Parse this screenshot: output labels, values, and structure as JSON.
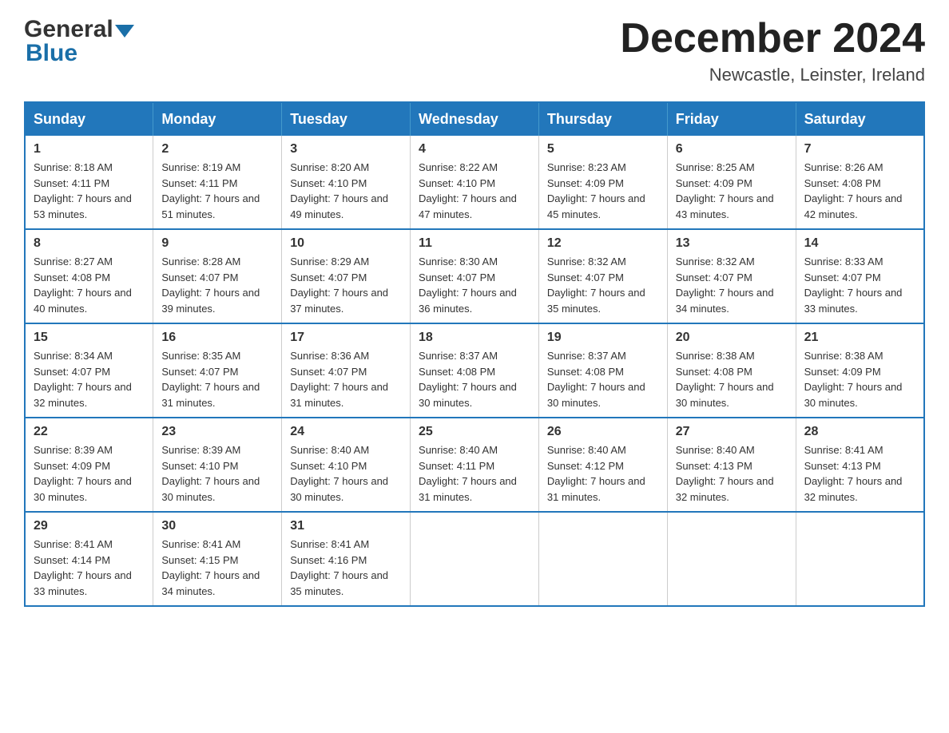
{
  "header": {
    "logo_general": "General",
    "logo_blue": "Blue",
    "month_title": "December 2024",
    "location": "Newcastle, Leinster, Ireland"
  },
  "weekdays": [
    "Sunday",
    "Monday",
    "Tuesday",
    "Wednesday",
    "Thursday",
    "Friday",
    "Saturday"
  ],
  "weeks": [
    [
      {
        "day": "1",
        "sunrise": "8:18 AM",
        "sunset": "4:11 PM",
        "daylight": "7 hours and 53 minutes."
      },
      {
        "day": "2",
        "sunrise": "8:19 AM",
        "sunset": "4:11 PM",
        "daylight": "7 hours and 51 minutes."
      },
      {
        "day": "3",
        "sunrise": "8:20 AM",
        "sunset": "4:10 PM",
        "daylight": "7 hours and 49 minutes."
      },
      {
        "day": "4",
        "sunrise": "8:22 AM",
        "sunset": "4:10 PM",
        "daylight": "7 hours and 47 minutes."
      },
      {
        "day": "5",
        "sunrise": "8:23 AM",
        "sunset": "4:09 PM",
        "daylight": "7 hours and 45 minutes."
      },
      {
        "day": "6",
        "sunrise": "8:25 AM",
        "sunset": "4:09 PM",
        "daylight": "7 hours and 43 minutes."
      },
      {
        "day": "7",
        "sunrise": "8:26 AM",
        "sunset": "4:08 PM",
        "daylight": "7 hours and 42 minutes."
      }
    ],
    [
      {
        "day": "8",
        "sunrise": "8:27 AM",
        "sunset": "4:08 PM",
        "daylight": "7 hours and 40 minutes."
      },
      {
        "day": "9",
        "sunrise": "8:28 AM",
        "sunset": "4:07 PM",
        "daylight": "7 hours and 39 minutes."
      },
      {
        "day": "10",
        "sunrise": "8:29 AM",
        "sunset": "4:07 PM",
        "daylight": "7 hours and 37 minutes."
      },
      {
        "day": "11",
        "sunrise": "8:30 AM",
        "sunset": "4:07 PM",
        "daylight": "7 hours and 36 minutes."
      },
      {
        "day": "12",
        "sunrise": "8:32 AM",
        "sunset": "4:07 PM",
        "daylight": "7 hours and 35 minutes."
      },
      {
        "day": "13",
        "sunrise": "8:32 AM",
        "sunset": "4:07 PM",
        "daylight": "7 hours and 34 minutes."
      },
      {
        "day": "14",
        "sunrise": "8:33 AM",
        "sunset": "4:07 PM",
        "daylight": "7 hours and 33 minutes."
      }
    ],
    [
      {
        "day": "15",
        "sunrise": "8:34 AM",
        "sunset": "4:07 PM",
        "daylight": "7 hours and 32 minutes."
      },
      {
        "day": "16",
        "sunrise": "8:35 AM",
        "sunset": "4:07 PM",
        "daylight": "7 hours and 31 minutes."
      },
      {
        "day": "17",
        "sunrise": "8:36 AM",
        "sunset": "4:07 PM",
        "daylight": "7 hours and 31 minutes."
      },
      {
        "day": "18",
        "sunrise": "8:37 AM",
        "sunset": "4:08 PM",
        "daylight": "7 hours and 30 minutes."
      },
      {
        "day": "19",
        "sunrise": "8:37 AM",
        "sunset": "4:08 PM",
        "daylight": "7 hours and 30 minutes."
      },
      {
        "day": "20",
        "sunrise": "8:38 AM",
        "sunset": "4:08 PM",
        "daylight": "7 hours and 30 minutes."
      },
      {
        "day": "21",
        "sunrise": "8:38 AM",
        "sunset": "4:09 PM",
        "daylight": "7 hours and 30 minutes."
      }
    ],
    [
      {
        "day": "22",
        "sunrise": "8:39 AM",
        "sunset": "4:09 PM",
        "daylight": "7 hours and 30 minutes."
      },
      {
        "day": "23",
        "sunrise": "8:39 AM",
        "sunset": "4:10 PM",
        "daylight": "7 hours and 30 minutes."
      },
      {
        "day": "24",
        "sunrise": "8:40 AM",
        "sunset": "4:10 PM",
        "daylight": "7 hours and 30 minutes."
      },
      {
        "day": "25",
        "sunrise": "8:40 AM",
        "sunset": "4:11 PM",
        "daylight": "7 hours and 31 minutes."
      },
      {
        "day": "26",
        "sunrise": "8:40 AM",
        "sunset": "4:12 PM",
        "daylight": "7 hours and 31 minutes."
      },
      {
        "day": "27",
        "sunrise": "8:40 AM",
        "sunset": "4:13 PM",
        "daylight": "7 hours and 32 minutes."
      },
      {
        "day": "28",
        "sunrise": "8:41 AM",
        "sunset": "4:13 PM",
        "daylight": "7 hours and 32 minutes."
      }
    ],
    [
      {
        "day": "29",
        "sunrise": "8:41 AM",
        "sunset": "4:14 PM",
        "daylight": "7 hours and 33 minutes."
      },
      {
        "day": "30",
        "sunrise": "8:41 AM",
        "sunset": "4:15 PM",
        "daylight": "7 hours and 34 minutes."
      },
      {
        "day": "31",
        "sunrise": "8:41 AM",
        "sunset": "4:16 PM",
        "daylight": "7 hours and 35 minutes."
      },
      null,
      null,
      null,
      null
    ]
  ],
  "labels": {
    "sunrise_prefix": "Sunrise: ",
    "sunset_prefix": "Sunset: ",
    "daylight_prefix": "Daylight: "
  }
}
